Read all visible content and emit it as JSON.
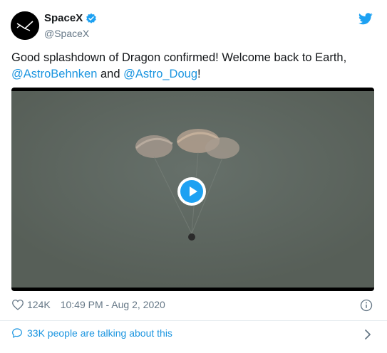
{
  "author": {
    "display_name": "SpaceX",
    "handle": "@SpaceX",
    "verified": true
  },
  "tweet": {
    "text_before": "Good splashdown of Dragon confirmed! Welcome back to Earth, ",
    "mention_1": "@AstroBehnken",
    "text_middle": " and ",
    "mention_2": "@Astro_Doug",
    "text_after": "!"
  },
  "media": {
    "type": "video",
    "play_icon": "play-icon"
  },
  "meta": {
    "likes": "124K",
    "timestamp": "10:49 PM - Aug 2, 2020"
  },
  "conversation": {
    "label": "33K people are talking about this"
  },
  "colors": {
    "accent": "#1da1f2",
    "link": "#1b95e0",
    "muted": "#657786",
    "video_bg": "#5b635c"
  },
  "icons": [
    "spacex-logo-icon",
    "verified-icon",
    "twitter-bird-icon",
    "heart-icon",
    "info-icon",
    "speech-bubble-icon",
    "chevron-right-icon"
  ]
}
